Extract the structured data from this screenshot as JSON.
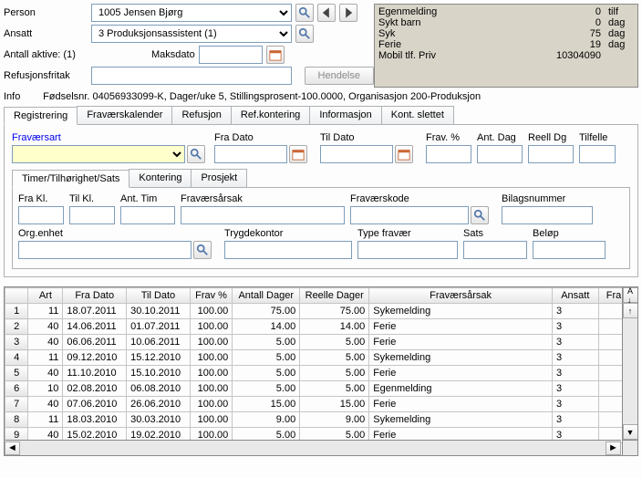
{
  "header": {
    "person_label": "Person",
    "person_value": "1005 Jensen Bjørg",
    "ansatt_label": "Ansatt",
    "ansatt_value": "3 Produksjonsassistent (1)",
    "antall_aktive_label": "Antall aktive: (1)",
    "maksdato_label": "Maksdato",
    "maksdato_value": "",
    "refusjon_label": "Refusjonsfritak",
    "refusjon_value": "",
    "hendelse_btn": "Hendelse",
    "info_label": "Info",
    "info_text": "Fødselsnr. 04056933099-K,  Dager/uke 5,  Stillingsprosent-100.0000,  Organisasjon 200-Produksjon"
  },
  "stats": [
    {
      "name": "Egenmelding",
      "value": "0",
      "unit": "tilf"
    },
    {
      "name": "Sykt barn",
      "value": "0",
      "unit": "dag"
    },
    {
      "name": "Syk",
      "value": "75",
      "unit": "dag"
    },
    {
      "name": "Ferie",
      "value": "19",
      "unit": "dag"
    },
    {
      "name": "Mobil tlf. Priv",
      "value": "10304090",
      "unit": ""
    }
  ],
  "tabs": [
    {
      "label": "Registrering",
      "active": true
    },
    {
      "label": "Fraværskalender"
    },
    {
      "label": "Refusjon"
    },
    {
      "label": "Ref.kontering"
    },
    {
      "label": "Informasjon"
    },
    {
      "label": "Kont. slettet"
    }
  ],
  "form": {
    "fravaersart_label": "Fraværsart",
    "fra_dato_label": "Fra Dato",
    "til_dato_label": "Til Dato",
    "frav_pct_label": "Frav. %",
    "ant_dag_label": "Ant. Dag",
    "reell_dg_label": "Reell Dg",
    "tilfelle_label": "Tilfelle"
  },
  "subtabs": [
    {
      "label": "Timer/Tilhørighet/Sats",
      "active": true
    },
    {
      "label": "Kontering"
    },
    {
      "label": "Prosjekt"
    }
  ],
  "sub": {
    "fra_kl": "Fra Kl.",
    "til_kl": "Til Kl.",
    "ant_tim": "Ant. Tim",
    "fravaersarsak": "Fraværsårsak",
    "fravaerskode": "Fraværskode",
    "bilagsnummer": "Bilagsnummer",
    "org_enhet": "Org.enhet",
    "trygdekontor": "Trygdekontor",
    "type_fravaer": "Type fravær",
    "sats": "Sats",
    "belop": "Beløp"
  },
  "grid": {
    "headers": [
      "",
      "Art",
      "Fra Dato",
      "Til Dato",
      "Frav %",
      "Antall Dager",
      "Reelle Dager",
      "Fraværsårsak",
      "Ansatt",
      "Fra k"
    ],
    "widths": [
      24,
      36,
      66,
      66,
      44,
      70,
      72,
      190,
      48,
      40
    ],
    "rows": [
      [
        "1",
        "11",
        "18.07.2011",
        "30.10.2011",
        "100.00",
        "75.00",
        "75.00",
        "Sykemelding",
        "3",
        ""
      ],
      [
        "2",
        "40",
        "14.06.2011",
        "01.07.2011",
        "100.00",
        "14.00",
        "14.00",
        "Ferie",
        "3",
        ""
      ],
      [
        "3",
        "40",
        "06.06.2011",
        "10.06.2011",
        "100.00",
        "5.00",
        "5.00",
        "Ferie",
        "3",
        ""
      ],
      [
        "4",
        "11",
        "09.12.2010",
        "15.12.2010",
        "100.00",
        "5.00",
        "5.00",
        "Sykemelding",
        "3",
        ""
      ],
      [
        "5",
        "40",
        "11.10.2010",
        "15.10.2010",
        "100.00",
        "5.00",
        "5.00",
        "Ferie",
        "3",
        ""
      ],
      [
        "6",
        "10",
        "02.08.2010",
        "06.08.2010",
        "100.00",
        "5.00",
        "5.00",
        "Egenmelding",
        "3",
        ""
      ],
      [
        "7",
        "40",
        "07.06.2010",
        "26.06.2010",
        "100.00",
        "15.00",
        "15.00",
        "Ferie",
        "3",
        ""
      ],
      [
        "8",
        "11",
        "18.03.2010",
        "30.03.2010",
        "100.00",
        "9.00",
        "9.00",
        "Sykemelding",
        "3",
        ""
      ],
      [
        "9",
        "40",
        "15.02.2010",
        "19.02.2010",
        "100.00",
        "5.00",
        "5.00",
        "Ferie",
        "3",
        ""
      ]
    ]
  }
}
